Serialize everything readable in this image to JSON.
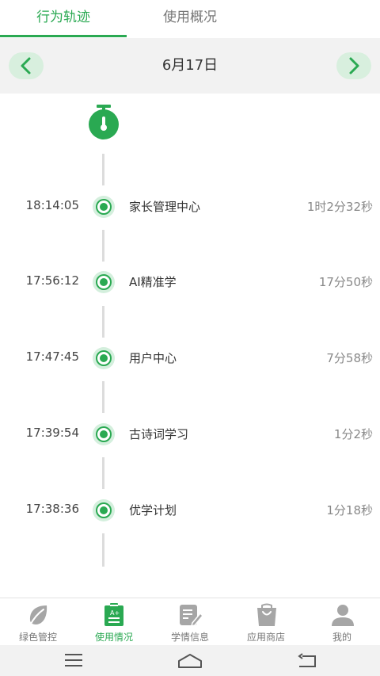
{
  "tabs": [
    {
      "label": "行为轨迹",
      "active": true
    },
    {
      "label": "使用概况",
      "active": false
    }
  ],
  "date_bar": {
    "date": "6月17日",
    "prev_icon": "chevron-left-icon",
    "next_icon": "chevron-right-icon"
  },
  "timeline": {
    "start_icon": "stopwatch-icon",
    "entries": [
      {
        "time": "18:14:05",
        "app": "家长管理中心",
        "duration": "1时2分32秒"
      },
      {
        "time": "17:56:12",
        "app": "AI精准学",
        "duration": "17分50秒"
      },
      {
        "time": "17:47:45",
        "app": "用户中心",
        "duration": "7分58秒"
      },
      {
        "time": "17:39:54",
        "app": "古诗词学习",
        "duration": "1分2秒"
      },
      {
        "time": "17:38:36",
        "app": "优学计划",
        "duration": "1分18秒"
      }
    ]
  },
  "bottom_nav": [
    {
      "label": "绿色管控",
      "icon": "leaf-icon",
      "active": false
    },
    {
      "label": "使用情况",
      "icon": "clipboard-icon",
      "active": true
    },
    {
      "label": "学情信息",
      "icon": "document-edit-icon",
      "active": false
    },
    {
      "label": "应用商店",
      "icon": "shopping-bag-icon",
      "active": false
    },
    {
      "label": "我的",
      "icon": "user-icon",
      "active": false
    }
  ],
  "system_nav": {
    "menu_icon": "menu-icon",
    "home_icon": "home-icon",
    "back_icon": "back-icon"
  },
  "colors": {
    "accent": "#2aa952",
    "accent_light": "#d8efde",
    "inactive": "#777777",
    "date_bar_bg": "#f2f2f2"
  }
}
